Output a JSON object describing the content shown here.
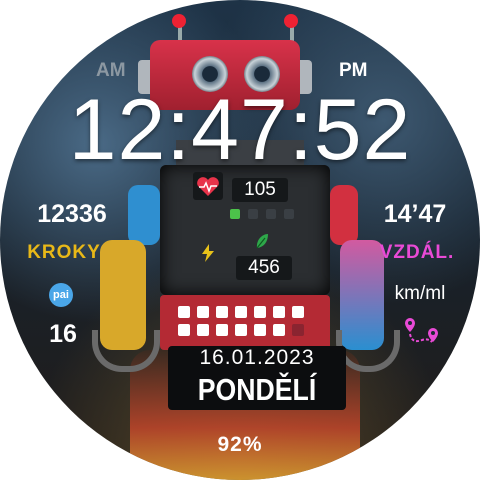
{
  "watch": {
    "time": "12:47:52",
    "am_label": "AM",
    "pm_label": "PM",
    "steps_value": "12336",
    "steps_label": "KROKY",
    "pai_label": "pai",
    "pai_value": "16",
    "distance_value": "14’47",
    "distance_label": "VZDÁL.",
    "distance_unit": "km/ml",
    "heart_rate": "105",
    "calories": "456",
    "date": "16.01.2023",
    "weekday": "PONDĚLÍ",
    "battery": "92%",
    "progress_cells_filled": 13,
    "progress_cells_total": 14
  },
  "colors": {
    "steps_label": "#e8b818",
    "distance_label": "#e94ad6",
    "pai_badge": "#4aa6e8",
    "am_inactive": "#8c98a2",
    "heart": "#e8334a",
    "leaf": "#2ea84a",
    "bolt": "#e8c21a"
  },
  "icons": {
    "heart": "heart-rate-icon",
    "leaf": "leaf-icon",
    "bolt": "bolt-icon",
    "route": "route-icon",
    "pai": "pai-icon"
  }
}
